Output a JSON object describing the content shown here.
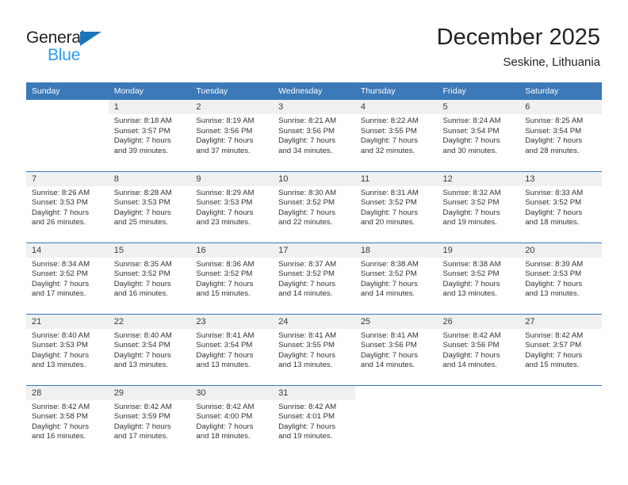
{
  "logo": {
    "word1": "General",
    "word2": "Blue",
    "triangle_color": "#1b75bb",
    "word2_color": "#2a9df4"
  },
  "header": {
    "title": "December 2025",
    "subtitle": "Seskine, Lithuania",
    "header_bg_color": "#3b79b8",
    "daynum_bg_color": "#f0f0f0"
  },
  "weekday_headers": [
    "Sunday",
    "Monday",
    "Tuesday",
    "Wednesday",
    "Thursday",
    "Friday",
    "Saturday"
  ],
  "weeks": [
    [
      {
        "day": "",
        "blank": true,
        "sunrise": "",
        "sunset": "",
        "daylight_line1": "",
        "daylight_line2": ""
      },
      {
        "day": "1",
        "sunrise": "Sunrise: 8:18 AM",
        "sunset": "Sunset: 3:57 PM",
        "daylight_line1": "Daylight: 7 hours",
        "daylight_line2": "and 39 minutes."
      },
      {
        "day": "2",
        "sunrise": "Sunrise: 8:19 AM",
        "sunset": "Sunset: 3:56 PM",
        "daylight_line1": "Daylight: 7 hours",
        "daylight_line2": "and 37 minutes."
      },
      {
        "day": "3",
        "sunrise": "Sunrise: 8:21 AM",
        "sunset": "Sunset: 3:56 PM",
        "daylight_line1": "Daylight: 7 hours",
        "daylight_line2": "and 34 minutes."
      },
      {
        "day": "4",
        "sunrise": "Sunrise: 8:22 AM",
        "sunset": "Sunset: 3:55 PM",
        "daylight_line1": "Daylight: 7 hours",
        "daylight_line2": "and 32 minutes."
      },
      {
        "day": "5",
        "sunrise": "Sunrise: 8:24 AM",
        "sunset": "Sunset: 3:54 PM",
        "daylight_line1": "Daylight: 7 hours",
        "daylight_line2": "and 30 minutes."
      },
      {
        "day": "6",
        "sunrise": "Sunrise: 8:25 AM",
        "sunset": "Sunset: 3:54 PM",
        "daylight_line1": "Daylight: 7 hours",
        "daylight_line2": "and 28 minutes."
      }
    ],
    [
      {
        "day": "7",
        "sunrise": "Sunrise: 8:26 AM",
        "sunset": "Sunset: 3:53 PM",
        "daylight_line1": "Daylight: 7 hours",
        "daylight_line2": "and 26 minutes."
      },
      {
        "day": "8",
        "sunrise": "Sunrise: 8:28 AM",
        "sunset": "Sunset: 3:53 PM",
        "daylight_line1": "Daylight: 7 hours",
        "daylight_line2": "and 25 minutes."
      },
      {
        "day": "9",
        "sunrise": "Sunrise: 8:29 AM",
        "sunset": "Sunset: 3:53 PM",
        "daylight_line1": "Daylight: 7 hours",
        "daylight_line2": "and 23 minutes."
      },
      {
        "day": "10",
        "sunrise": "Sunrise: 8:30 AM",
        "sunset": "Sunset: 3:52 PM",
        "daylight_line1": "Daylight: 7 hours",
        "daylight_line2": "and 22 minutes."
      },
      {
        "day": "11",
        "sunrise": "Sunrise: 8:31 AM",
        "sunset": "Sunset: 3:52 PM",
        "daylight_line1": "Daylight: 7 hours",
        "daylight_line2": "and 20 minutes."
      },
      {
        "day": "12",
        "sunrise": "Sunrise: 8:32 AM",
        "sunset": "Sunset: 3:52 PM",
        "daylight_line1": "Daylight: 7 hours",
        "daylight_line2": "and 19 minutes."
      },
      {
        "day": "13",
        "sunrise": "Sunrise: 8:33 AM",
        "sunset": "Sunset: 3:52 PM",
        "daylight_line1": "Daylight: 7 hours",
        "daylight_line2": "and 18 minutes."
      }
    ],
    [
      {
        "day": "14",
        "sunrise": "Sunrise: 8:34 AM",
        "sunset": "Sunset: 3:52 PM",
        "daylight_line1": "Daylight: 7 hours",
        "daylight_line2": "and 17 minutes."
      },
      {
        "day": "15",
        "sunrise": "Sunrise: 8:35 AM",
        "sunset": "Sunset: 3:52 PM",
        "daylight_line1": "Daylight: 7 hours",
        "daylight_line2": "and 16 minutes."
      },
      {
        "day": "16",
        "sunrise": "Sunrise: 8:36 AM",
        "sunset": "Sunset: 3:52 PM",
        "daylight_line1": "Daylight: 7 hours",
        "daylight_line2": "and 15 minutes."
      },
      {
        "day": "17",
        "sunrise": "Sunrise: 8:37 AM",
        "sunset": "Sunset: 3:52 PM",
        "daylight_line1": "Daylight: 7 hours",
        "daylight_line2": "and 14 minutes."
      },
      {
        "day": "18",
        "sunrise": "Sunrise: 8:38 AM",
        "sunset": "Sunset: 3:52 PM",
        "daylight_line1": "Daylight: 7 hours",
        "daylight_line2": "and 14 minutes."
      },
      {
        "day": "19",
        "sunrise": "Sunrise: 8:38 AM",
        "sunset": "Sunset: 3:52 PM",
        "daylight_line1": "Daylight: 7 hours",
        "daylight_line2": "and 13 minutes."
      },
      {
        "day": "20",
        "sunrise": "Sunrise: 8:39 AM",
        "sunset": "Sunset: 3:53 PM",
        "daylight_line1": "Daylight: 7 hours",
        "daylight_line2": "and 13 minutes."
      }
    ],
    [
      {
        "day": "21",
        "sunrise": "Sunrise: 8:40 AM",
        "sunset": "Sunset: 3:53 PM",
        "daylight_line1": "Daylight: 7 hours",
        "daylight_line2": "and 13 minutes."
      },
      {
        "day": "22",
        "sunrise": "Sunrise: 8:40 AM",
        "sunset": "Sunset: 3:54 PM",
        "daylight_line1": "Daylight: 7 hours",
        "daylight_line2": "and 13 minutes."
      },
      {
        "day": "23",
        "sunrise": "Sunrise: 8:41 AM",
        "sunset": "Sunset: 3:54 PM",
        "daylight_line1": "Daylight: 7 hours",
        "daylight_line2": "and 13 minutes."
      },
      {
        "day": "24",
        "sunrise": "Sunrise: 8:41 AM",
        "sunset": "Sunset: 3:55 PM",
        "daylight_line1": "Daylight: 7 hours",
        "daylight_line2": "and 13 minutes."
      },
      {
        "day": "25",
        "sunrise": "Sunrise: 8:41 AM",
        "sunset": "Sunset: 3:56 PM",
        "daylight_line1": "Daylight: 7 hours",
        "daylight_line2": "and 14 minutes."
      },
      {
        "day": "26",
        "sunrise": "Sunrise: 8:42 AM",
        "sunset": "Sunset: 3:56 PM",
        "daylight_line1": "Daylight: 7 hours",
        "daylight_line2": "and 14 minutes."
      },
      {
        "day": "27",
        "sunrise": "Sunrise: 8:42 AM",
        "sunset": "Sunset: 3:57 PM",
        "daylight_line1": "Daylight: 7 hours",
        "daylight_line2": "and 15 minutes."
      }
    ],
    [
      {
        "day": "28",
        "sunrise": "Sunrise: 8:42 AM",
        "sunset": "Sunset: 3:58 PM",
        "daylight_line1": "Daylight: 7 hours",
        "daylight_line2": "and 16 minutes."
      },
      {
        "day": "29",
        "sunrise": "Sunrise: 8:42 AM",
        "sunset": "Sunset: 3:59 PM",
        "daylight_line1": "Daylight: 7 hours",
        "daylight_line2": "and 17 minutes."
      },
      {
        "day": "30",
        "sunrise": "Sunrise: 8:42 AM",
        "sunset": "Sunset: 4:00 PM",
        "daylight_line1": "Daylight: 7 hours",
        "daylight_line2": "and 18 minutes."
      },
      {
        "day": "31",
        "sunrise": "Sunrise: 8:42 AM",
        "sunset": "Sunset: 4:01 PM",
        "daylight_line1": "Daylight: 7 hours",
        "daylight_line2": "and 19 minutes."
      },
      {
        "day": "",
        "blank": true,
        "sunrise": "",
        "sunset": "",
        "daylight_line1": "",
        "daylight_line2": ""
      },
      {
        "day": "",
        "blank": true,
        "sunrise": "",
        "sunset": "",
        "daylight_line1": "",
        "daylight_line2": ""
      },
      {
        "day": "",
        "blank": true,
        "sunrise": "",
        "sunset": "",
        "daylight_line1": "",
        "daylight_line2": ""
      }
    ]
  ]
}
